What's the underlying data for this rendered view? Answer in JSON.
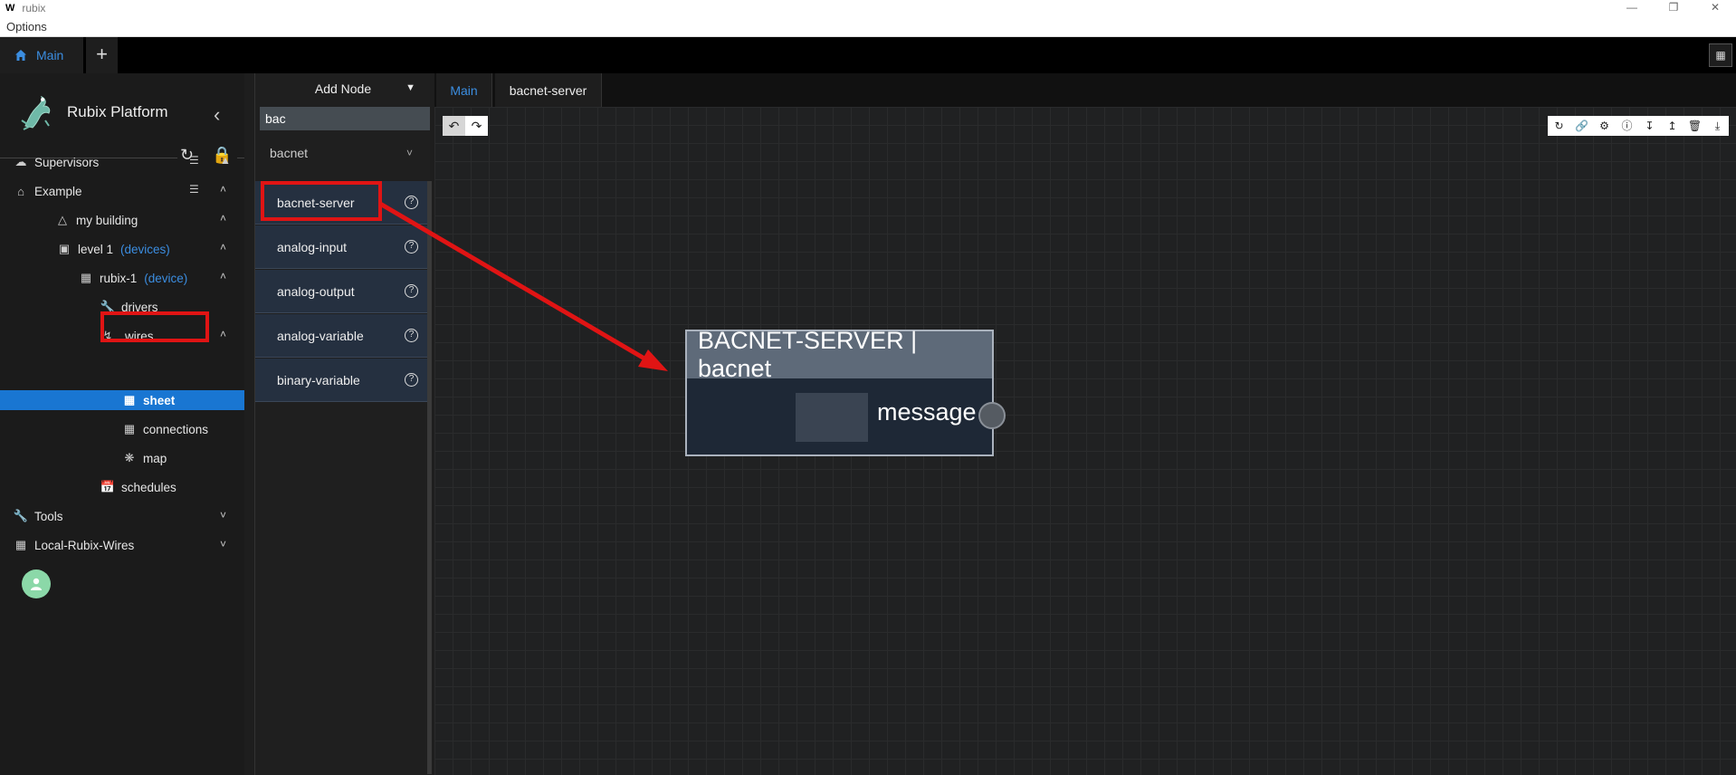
{
  "window": {
    "logo": "W",
    "title": "rubix",
    "menu": "Options"
  },
  "tabs": {
    "main_label": "Main",
    "add_label": "+"
  },
  "sidebar": {
    "brand": "Rubix Platform",
    "tree": [
      {
        "label": "Supervisors"
      },
      {
        "label": "Example"
      },
      {
        "label": "my building"
      },
      {
        "label": "level 1",
        "tag": "(devices)"
      },
      {
        "label": "rubix-1",
        "tag": "(device)"
      },
      {
        "label": "drivers"
      },
      {
        "label": "wires"
      },
      {
        "label": "sheet"
      },
      {
        "label": "connections"
      },
      {
        "label": "map"
      },
      {
        "label": "schedules"
      },
      {
        "label": "Tools"
      },
      {
        "label": "Local-Rubix-Wires"
      }
    ]
  },
  "node_panel": {
    "title": "Add Node",
    "search_value": "bac",
    "category": "bacnet",
    "items": [
      {
        "label": "bacnet-server"
      },
      {
        "label": "analog-input"
      },
      {
        "label": "analog-output"
      },
      {
        "label": "analog-variable"
      },
      {
        "label": "binary-variable"
      }
    ]
  },
  "editor": {
    "tabs": [
      {
        "label": "Main"
      },
      {
        "label": "bacnet-server"
      }
    ]
  },
  "node": {
    "title": "BACNET-SERVER | bacnet",
    "output": "message"
  },
  "colors": {
    "accent": "#1976d2",
    "annotation": "#e01414",
    "node_header": "#5e6a79"
  }
}
